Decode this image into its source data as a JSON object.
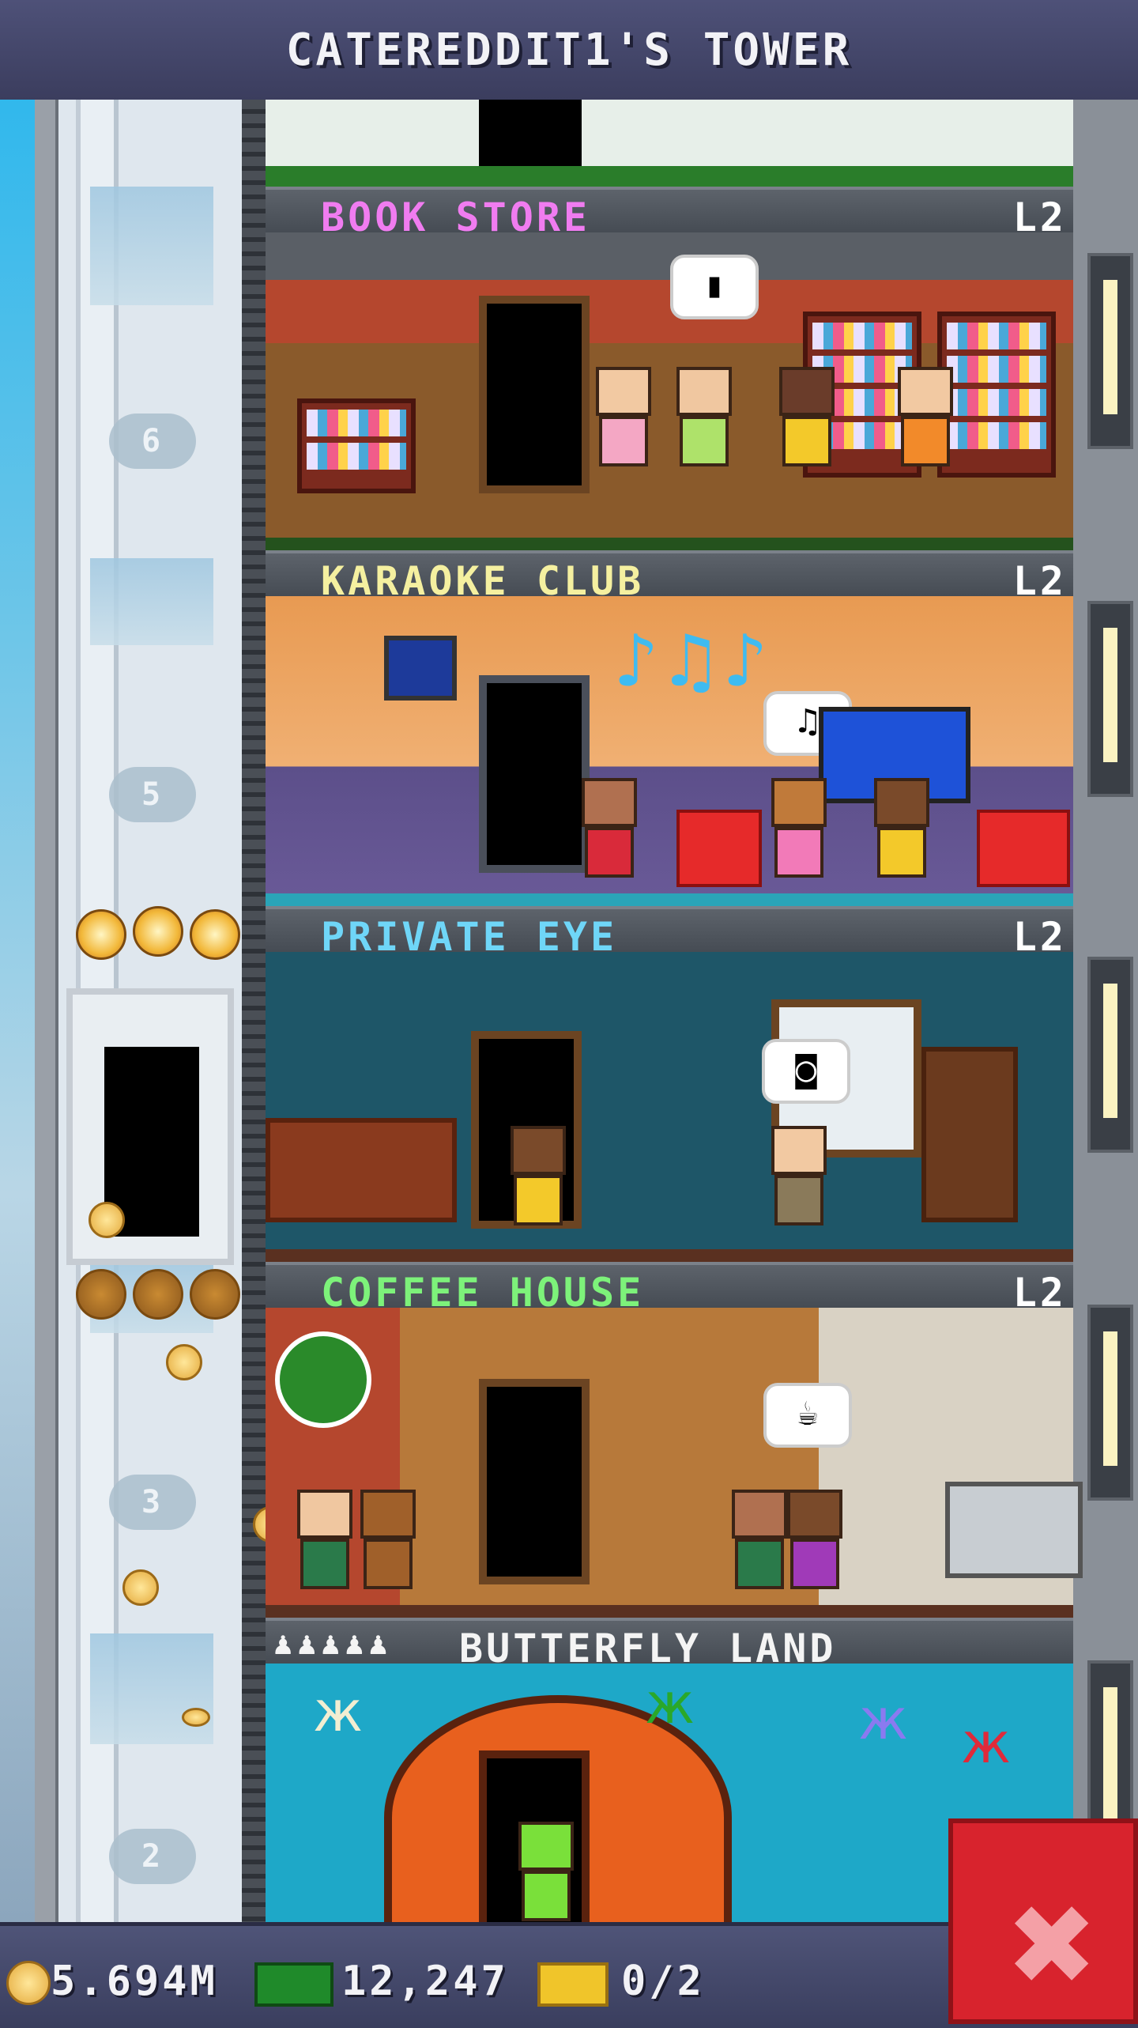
{
  "header": {
    "title": "CATEREDDIT1'S TOWER"
  },
  "elevator": {
    "floor_labels": [
      "6",
      "5",
      "3",
      "2"
    ]
  },
  "floors": [
    {
      "name": "BOOK STORE",
      "level": "L2",
      "name_color": "#f07cf0"
    },
    {
      "name": "KARAOKE CLUB",
      "level": "L2",
      "name_color": "#f5f0a0"
    },
    {
      "name": "PRIVATE EYE",
      "level": "L2",
      "name_color": "#6fd6f8"
    },
    {
      "name": "COFFEE HOUSE",
      "level": "L2",
      "name_color": "#7df27a"
    },
    {
      "name": "BUTTERFLY LAND",
      "level": "",
      "name_color": "#f4f4f4",
      "stars": "♟♟♟♟♟"
    }
  ],
  "stats": {
    "coins": "5.694M",
    "bux": "12,247",
    "tickets": "0/2"
  },
  "colors": {
    "header_bg": "#44476b",
    "close_button": "#d8232d"
  }
}
